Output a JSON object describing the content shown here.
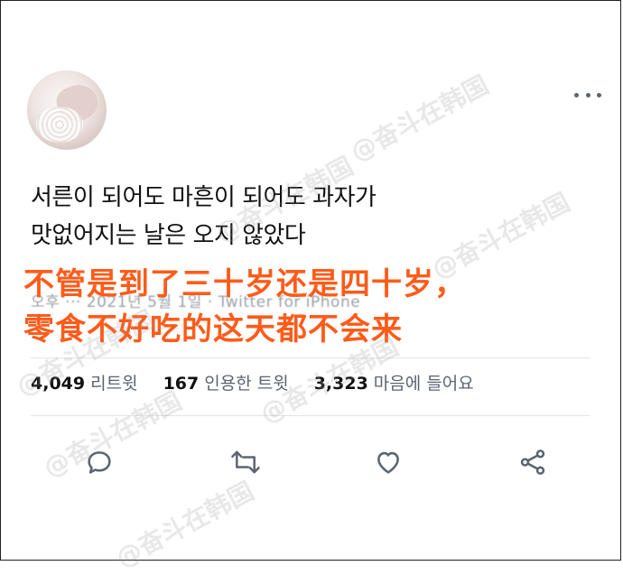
{
  "tweet": {
    "text_line1": "서른이 되어도 마흔이 되어도 과자가",
    "text_line2": "맛없어지는 날은 오지 않았다",
    "meta": "오후 ··· 2021년 5월 1일 · Twitter for iPhone"
  },
  "overlay": {
    "line1": "不管是到了三十岁还是四十岁，",
    "line2": "零食不好吃的这天都不会来",
    "color": "#ff5b1a"
  },
  "stats": {
    "retweets_count": "4,049",
    "retweets_label": "리트윗",
    "quotes_count": "167",
    "quotes_label": "인용한 트윗",
    "likes_count": "3,323",
    "likes_label": "마음에 들어요"
  },
  "watermark": {
    "text": "@奋斗在韩国"
  },
  "icons": {
    "more": "more-dots-icon",
    "reply": "reply-icon",
    "retweet": "retweet-icon",
    "like": "heart-icon",
    "share": "share-icon"
  }
}
